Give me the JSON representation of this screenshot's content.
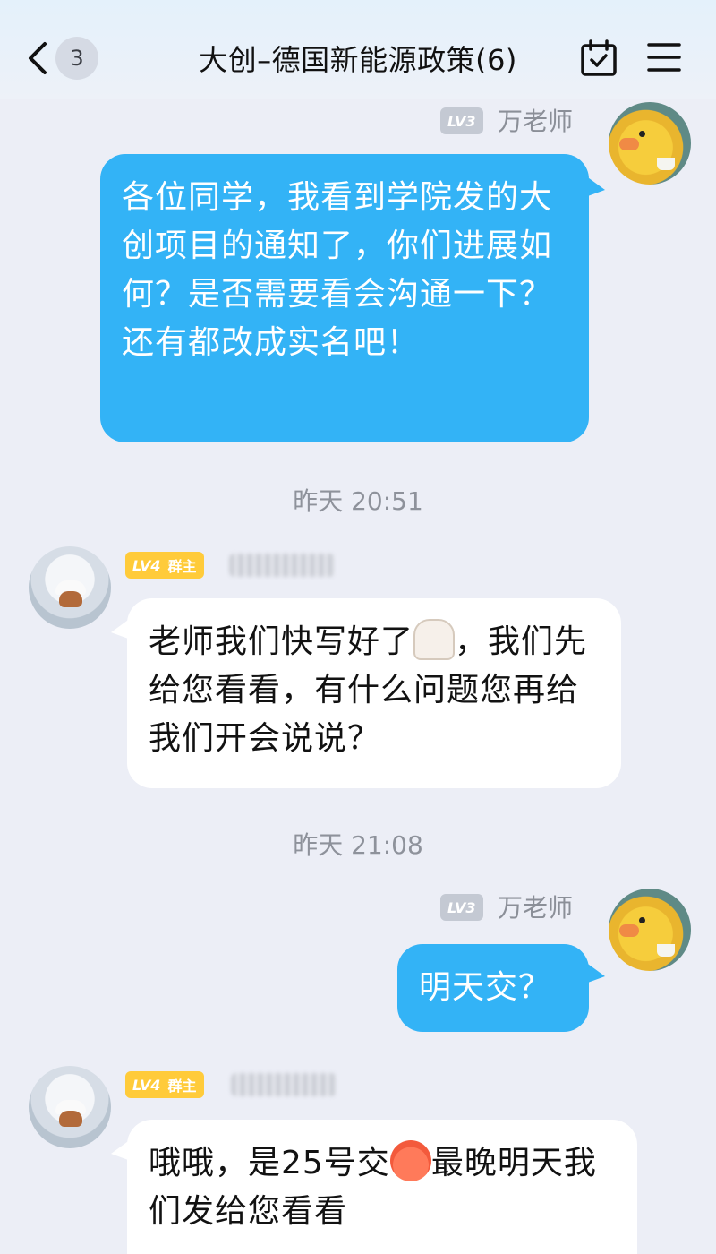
{
  "header": {
    "back_badge": "3",
    "title": "大创–德国新能源政策(6)",
    "calendar_icon": "calendar-check-icon",
    "menu_icon": "hamburger-menu-icon"
  },
  "messages": [
    {
      "level": "LV3",
      "sender": "万老师",
      "text": "各位同学，我看到学院发的大创项目的通知了，你们进展如何？是否需要看会沟通一下？还有都改成实名吧！"
    },
    {
      "timestamp": "昨天 20:51"
    },
    {
      "level": "LV4",
      "role": "群主",
      "text_before": "老师我们快写好了",
      "emoji": "alpaca-emoji",
      "text_after": "，我们先给您看看，有什么问题您再给我们开会说说？"
    },
    {
      "timestamp": "昨天 21:08"
    },
    {
      "level": "LV3",
      "sender": "万老师",
      "text": "明天交？"
    },
    {
      "level": "LV4",
      "role": "群主",
      "text_before": "哦哦，是25号交",
      "emoji": "sad-face-emoji",
      "text_after": "最晚明天我们发给您看看"
    }
  ],
  "colors": {
    "accent_blue": "#33b3f6",
    "background": "#eceef6",
    "owner_badge": "#ffcb3a"
  }
}
